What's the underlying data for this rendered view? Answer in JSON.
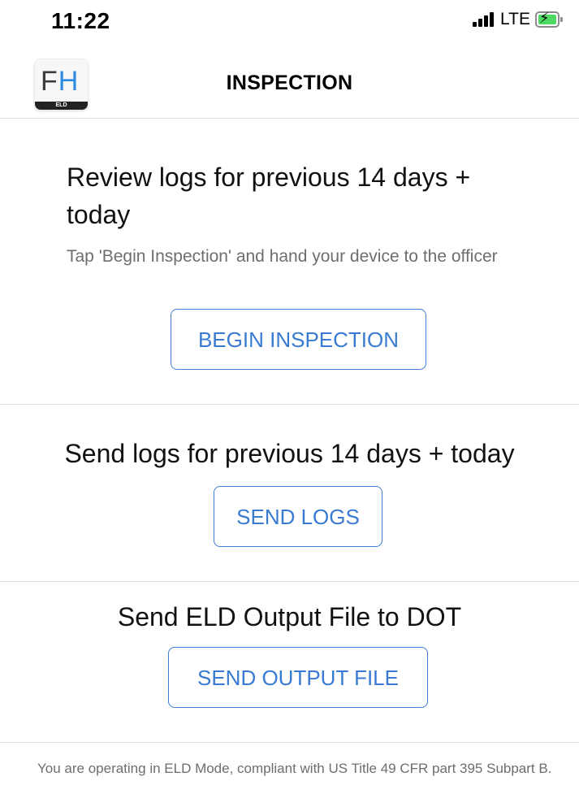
{
  "status_bar": {
    "time": "11:22",
    "network": "LTE",
    "icons": [
      "signal-icon",
      "battery-charging-icon"
    ],
    "battery_color": "#4cd964"
  },
  "header": {
    "logo": {
      "letters_f": "F",
      "letters_h": "H",
      "band_text": "ELD"
    },
    "title": "INSPECTION"
  },
  "review": {
    "heading": "Review logs for previous 14 days + today",
    "instructions": "Tap 'Begin Inspection' and hand your device to the officer",
    "button_label": "BEGIN INSPECTION"
  },
  "send_logs": {
    "heading": "Send logs for previous 14 days + today",
    "button_label": "SEND LOGS"
  },
  "output_file": {
    "heading": "Send ELD Output File to DOT",
    "button_label": "SEND OUTPUT FILE"
  },
  "footer": {
    "note": "You are operating in ELD Mode, compliant with US Title 49 CFR part 395 Subpart  B."
  },
  "colors": {
    "accent": "#3a7bd2",
    "secondary_text": "#6d6d72",
    "divider": "#e2e2e2"
  }
}
